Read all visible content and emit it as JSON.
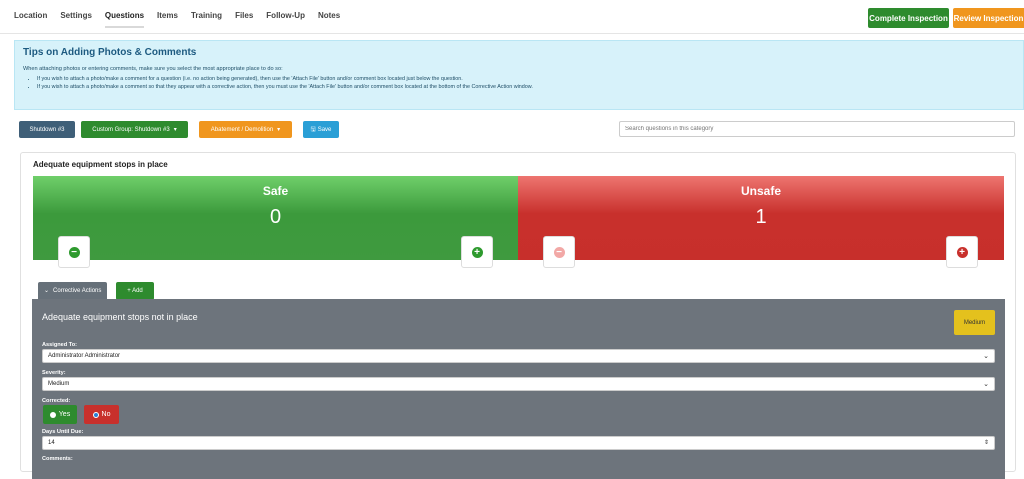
{
  "nav": {
    "tabs": [
      "Location",
      "Settings",
      "Questions",
      "Items",
      "Training",
      "Files",
      "Follow-Up",
      "Notes"
    ],
    "active_tab": "Questions",
    "complete_label": "Complete Inspection",
    "review_label": "Review Inspection"
  },
  "tips": {
    "title": "Tips on Adding Photos & Comments",
    "intro": "When attaching photos or entering comments, make sure you select the most appropriate place to do so:",
    "bullets": [
      "If you wish to attach a photo/make a comment for a question (i.e. no action being generated), then use the 'Attach File' button and/or comment box located just below the question.",
      "If you wish to attach a photo/make a comment so that they appear with a corrective action, then you must use the 'Attach File' button and/or comment box located at the bottom of the Corrective Action window."
    ]
  },
  "filters": {
    "shutdown": "Shutdown #3",
    "custom_group": "Custom Group: Shutdown #3",
    "abatement": "Abatement / Demolition",
    "save": "Save",
    "search_placeholder": "Search questions in this category"
  },
  "question": {
    "title": "Adequate equipment stops in place",
    "safe_label": "Safe",
    "safe_count": "0",
    "unsafe_label": "Unsafe",
    "unsafe_count": "1"
  },
  "corrective": {
    "tab_label": "Corrective Actions",
    "add_label": "+ Add",
    "title": "Adequate equipment stops not in place",
    "badge": "Medium",
    "assigned_label": "Assigned To:",
    "assigned_value": "Administrator Administrator",
    "severity_label": "Severity:",
    "severity_value": "Medium",
    "corrected_label": "Corrected:",
    "yes_label": "Yes",
    "no_label": "No",
    "days_label": "Days Until Due:",
    "days_value": "14",
    "comments_label": "Comments:"
  },
  "colors": {
    "safe": "#3c9a3c",
    "unsafe": "#c8302c",
    "complete": "#2e8b2e",
    "review": "#f0961e",
    "shutdown": "#3f5f78",
    "custom_group": "#2e8b2e",
    "abatement": "#f0961e",
    "save": "#2a9fd6",
    "badge": "#e4c11d"
  },
  "icons": {
    "minus": "minus-circle-icon",
    "plus": "plus-circle-icon",
    "chevron": "chevron-down-icon",
    "save": "floppy-disk-icon"
  }
}
